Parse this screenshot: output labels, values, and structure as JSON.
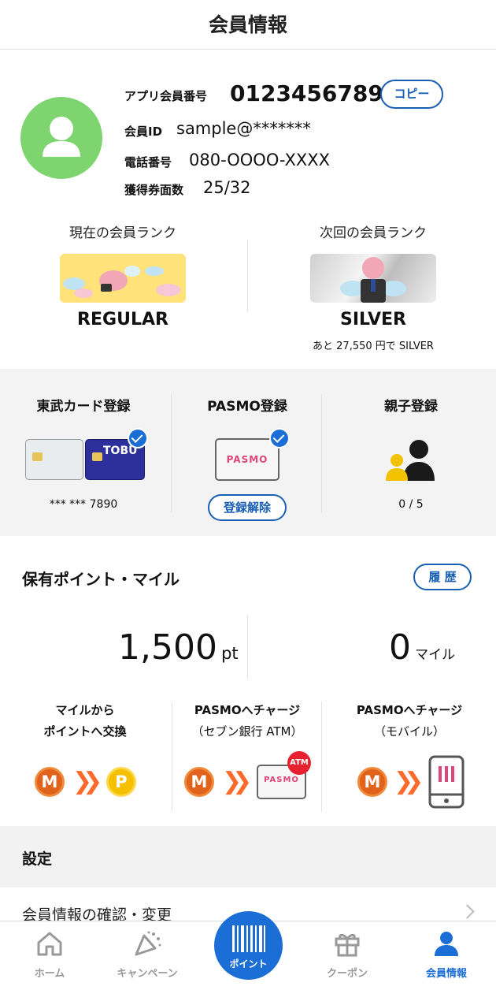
{
  "header": {
    "title": "会員情報"
  },
  "profile": {
    "app_member_label": "アプリ会員番号",
    "app_member_number": "0123456789",
    "copy_label": "コピー",
    "member_id_label": "会員ID",
    "member_id": "sample@*******",
    "phone_label": "電話番号",
    "phone": "080-OOOO-XXXX",
    "coupon_label": "獲得券面数",
    "coupon_count": "25/32"
  },
  "rank": {
    "current_caption": "現在の会員ランク",
    "current_name": "REGULAR",
    "next_caption": "次回の会員ランク",
    "next_name": "SILVER",
    "next_note": "あと 27,550 円で SILVER"
  },
  "registration": {
    "tobu": {
      "title": "東武カード登録",
      "card_brand": "TOBU",
      "card_number": "*** *** 7890"
    },
    "pasmo": {
      "title": "PASMO登録",
      "card_word": "PASMO",
      "unregister_label": "登録解除"
    },
    "family": {
      "title": "親子登録",
      "count": "0 / 5"
    }
  },
  "points": {
    "title": "保有ポイント・マイル",
    "history_label": "履 歴",
    "points_value": "1,500",
    "points_unit": "pt",
    "miles_value": "0",
    "miles_unit": "マイル"
  },
  "exchange": [
    {
      "line1": "マイルから",
      "line2": "ポイントへ交換",
      "from": "M",
      "to": "P"
    },
    {
      "line1": "PASMOへチャージ",
      "line2": "（セブン銀行 ATM）",
      "from": "M",
      "badge": "ATM",
      "card_word": "PASMO"
    },
    {
      "line1": "PASMOへチャージ",
      "line2": "（モバイル）",
      "from": "M"
    }
  ],
  "settings": {
    "title": "設定",
    "item1": "会員情報の確認・変更"
  },
  "tabbar": {
    "home": "ホーム",
    "campaign": "キャンペーン",
    "point": "ポイント",
    "coupon": "クーポン",
    "member": "会員情報"
  },
  "colors": {
    "accent": "#1b6ed6",
    "avatar": "#7ed56f",
    "mile_orange": "#e1621b",
    "point_yellow": "#f5c000"
  }
}
